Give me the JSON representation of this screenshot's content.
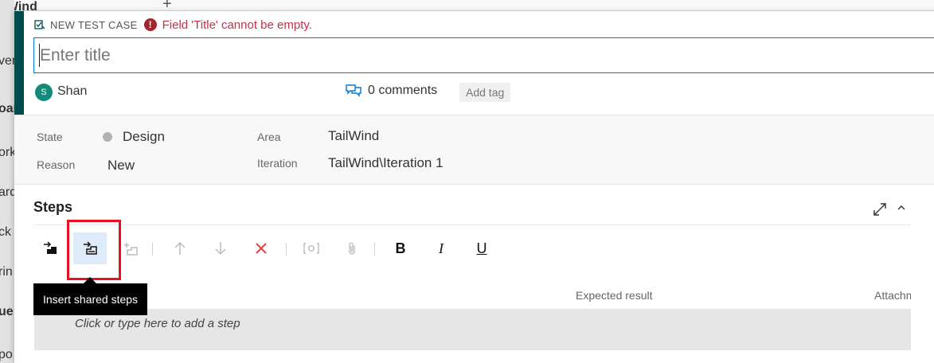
{
  "background": {
    "brand": "ilWind",
    "sidebar_items": [
      {
        "label": "ver",
        "bold": false
      },
      {
        "label": "oar",
        "bold": true
      },
      {
        "label": "ork",
        "bold": false
      },
      {
        "label": "ard",
        "bold": false
      },
      {
        "label": "ck",
        "bold": false
      },
      {
        "label": "rin",
        "bold": false
      },
      {
        "label": "ue",
        "bold": true
      },
      {
        "label": "po",
        "bold": false
      }
    ],
    "plus_glyph": "+"
  },
  "dialog": {
    "work_item_type": "NEW TEST CASE",
    "error_icon_glyph": "!",
    "error_message": "Field 'Title' cannot be empty.",
    "title": {
      "value": "",
      "placeholder": "Enter title"
    },
    "owner": {
      "initial": "S",
      "name": "Shan"
    },
    "comments_label": "0 comments",
    "add_tag_label": "Add tag",
    "fields": {
      "state_label": "State",
      "state_value": "Design",
      "state_color": "#b2b2b2",
      "reason_label": "Reason",
      "reason_value": "New",
      "area_label": "Area",
      "area_value": "TailWind",
      "iteration_label": "Iteration",
      "iteration_value": "TailWind\\Iteration 1"
    },
    "steps": {
      "title": "Steps",
      "toolbar": {
        "bold_glyph": "B",
        "italic_glyph": "I",
        "underline_glyph": "U"
      },
      "tooltip": "Insert shared steps",
      "col_expected": "Expected result",
      "col_attachments": "Attachments",
      "add_step_placeholder": "Click or type here to add a step"
    }
  },
  "colors": {
    "accent": "#004b50",
    "error": "#c4314b",
    "focus": "#0078d4",
    "highlight": "#e81123",
    "avatar": "#138a7a"
  }
}
